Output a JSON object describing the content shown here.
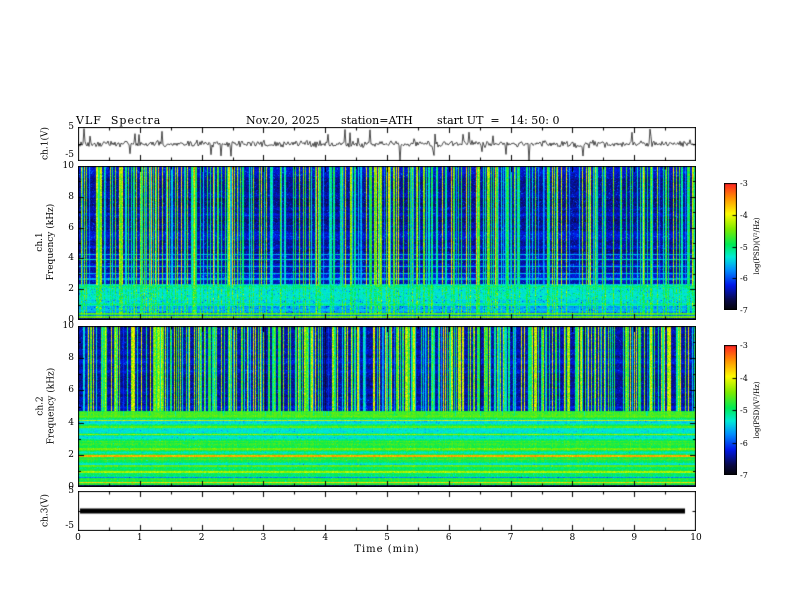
{
  "header": {
    "title": "VLF  Spectra",
    "date": "Nov.20, 2025",
    "station": "station=ATH",
    "start_ut": "start UT  =   14: 50: 0"
  },
  "panels": {
    "ch1_wave": {
      "label": "ch.1(V)",
      "ymax": "5",
      "ymin": "-5"
    },
    "ch1_spec": {
      "label_ch": "ch.1",
      "label_axis": "Frequency (kHz)"
    },
    "ch2_spec": {
      "label_ch": "ch.2",
      "label_axis": "Frequency (kHz)"
    },
    "ch3_wave": {
      "label": "ch.3(V)",
      "ymax": "5",
      "ymin": "-5"
    }
  },
  "axes": {
    "spec_yticks": [
      "0",
      "2",
      "4",
      "6",
      "8",
      "10"
    ],
    "x_ticks": [
      "0",
      "1",
      "2",
      "3",
      "4",
      "5",
      "6",
      "7",
      "8",
      "9",
      "10"
    ],
    "x_label": "Time (min)"
  },
  "colorbar": {
    "label": "log(PSD)(V²/Hz)",
    "ticks": [
      "-3",
      "-4",
      "-5",
      "-6",
      "-7"
    ]
  },
  "chart_data": [
    {
      "type": "line",
      "name": "ch1-waveform",
      "ylabel": "ch.1(V)",
      "xlim": [
        0,
        10
      ],
      "ylim": [
        -5,
        5
      ],
      "description": "Broadband noise centred on 0 V with dense impulsive spikes (atmospherics) reaching about ±5 V throughout the 10-minute record"
    },
    {
      "type": "heatmap",
      "name": "ch1-spectrogram",
      "ylabel": "ch.1 Frequency (kHz)",
      "xlabel": "Time (min)",
      "xlim": [
        0,
        10
      ],
      "ylim": [
        0,
        10
      ],
      "zlabel": "log(PSD)(V²/Hz)",
      "zlim": [
        -7,
        -3
      ],
      "colormap": "rainbow (black -7 → blue → cyan → green → yellow → red -3)",
      "background_log_psd": -6.4,
      "streak_fraction": 0.45,
      "low_band_top_khz": 2.3,
      "cyan_line_khz": [
        2.35,
        2.7,
        3.05,
        3.5,
        3.95,
        4.3
      ],
      "features": [
        "dense broadband vertical streaks from ~1.5 to 10 kHz, green-yellow with red tops near 9-10 kHz",
        "dark blue background near -6.5 between streaks in the 2.5-8 kHz range",
        "cyan/green layered emission below ~2.3 kHz",
        "narrow intense green-yellow bands below ~0.5 kHz with dark gaps near 0.1 and 0.3 kHz"
      ]
    },
    {
      "type": "heatmap",
      "name": "ch2-spectrogram",
      "ylabel": "ch.2 Frequency (kHz)",
      "xlabel": "Time (min)",
      "xlim": [
        0,
        10
      ],
      "ylim": [
        0,
        10
      ],
      "zlabel": "log(PSD)(V²/Hz)",
      "zlim": [
        -7,
        -3
      ],
      "colormap": "rainbow (black -7 → blue → cyan → green → yellow → red -3)",
      "background_log_psd": -6.4,
      "streak_fraction": 0.5,
      "green_region_top_khz": 4.75,
      "horizontal_bands": [
        [
          0.3,
          -3.8
        ],
        [
          0.62,
          -5.8
        ],
        [
          0.95,
          -4.3
        ],
        [
          1.35,
          -4.6
        ],
        [
          1.75,
          -4.7
        ],
        [
          1.95,
          -3.6
        ],
        [
          2.4,
          -4.5
        ],
        [
          2.85,
          -4.7
        ],
        [
          3.3,
          -4.4
        ],
        [
          3.75,
          -4.6
        ],
        [
          4.15,
          -4.2
        ]
      ],
      "features": [
        "vertical green/yellow streaks on dark blue background above ~4.8 kHz with occasional black gaps",
        "continuous green emission with horizontal banding below ~4.7 kHz",
        "bright yellow/red narrow bands near 0.3, 0.95, 1.95 and 4.15 kHz",
        "dark gap near 0.6 kHz and a black strip at the 0 kHz edge"
      ]
    },
    {
      "type": "line",
      "name": "ch3-waveform",
      "ylabel": "ch.3(V)",
      "xlim": [
        0,
        10
      ],
      "ylim": [
        -5,
        5
      ],
      "description": "Flat heavy trace at ~0 V (no signal) extending from 0 to ~9.8 min"
    }
  ]
}
